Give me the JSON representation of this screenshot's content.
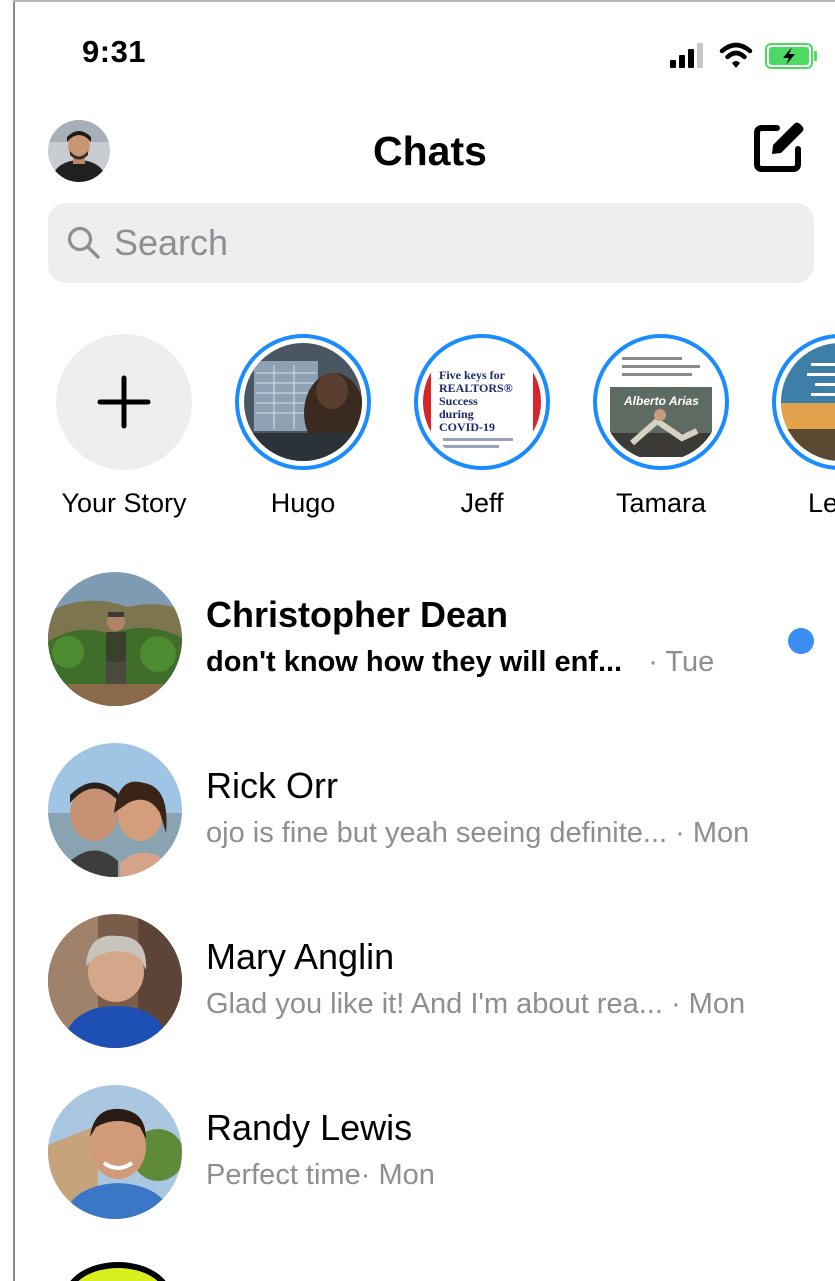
{
  "status_bar": {
    "time": "9:31"
  },
  "header": {
    "title": "Chats"
  },
  "search": {
    "placeholder": "Search"
  },
  "stories": [
    {
      "label": "Your Story",
      "type": "add"
    },
    {
      "label": "Hugo"
    },
    {
      "label": "Jeff",
      "image_text": [
        "Five keys for",
        "REALTORS®",
        "Success",
        "during",
        "COVID-19"
      ]
    },
    {
      "label": "Tamara",
      "image_text": [
        "Alberto Arias"
      ]
    },
    {
      "label": "Le"
    }
  ],
  "chats": [
    {
      "name": "Christopher Dean",
      "message": "don't know how they will enf...",
      "time": "· Tue",
      "unread": true
    },
    {
      "name": "Rick Orr",
      "message": "ojo is fine but yeah seeing definite...",
      "time": "· Mon",
      "unread": false
    },
    {
      "name": "Mary Anglin",
      "message": "Glad you like it!  And I'm about rea...",
      "time": "· Mon",
      "unread": false
    },
    {
      "name": "Randy Lewis",
      "message": "Perfect time",
      "time": "· Mon",
      "unread": false
    }
  ],
  "colors": {
    "accent": "#1a8cff",
    "unread_dot": "#3a8ef5",
    "search_bg": "#eeeeef",
    "secondary_text": "#8e8e93",
    "battery": "#4cd964"
  },
  "icons": [
    "cellular-signal-icon",
    "wifi-icon",
    "battery-charging-icon",
    "compose-icon",
    "search-icon",
    "plus-icon"
  ]
}
